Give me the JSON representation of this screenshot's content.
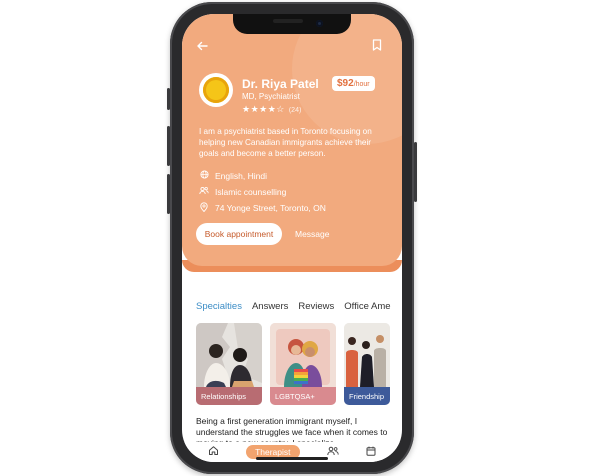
{
  "header": {
    "back_icon": "arrow-left-icon",
    "bookmark_icon": "bookmark-icon"
  },
  "therapist": {
    "name": "Dr. Riya Patel",
    "credentials": "MD, Psychiatrist",
    "stars": "★★★★☆",
    "rating": 4,
    "review_count": "(24)",
    "price": "$92",
    "price_unit": "/hour",
    "bio": "I am a psychiatrist based in Toronto focusing on helping new Canadian immigrants achieve their goals and become a better person.",
    "languages": "English, Hindi",
    "counselling": "Islamic counselling",
    "address": "74 Yonge Street, Toronto, ON"
  },
  "actions": {
    "book_label": "Book appointment",
    "message_label": "Message"
  },
  "tabs": [
    {
      "label": "Specialties",
      "active": true
    },
    {
      "label": "Answers",
      "active": false
    },
    {
      "label": "Reviews",
      "active": false
    },
    {
      "label": "Office Ame",
      "active": false
    }
  ],
  "specialties": [
    {
      "label": "Relationships",
      "color": "#b86c72"
    },
    {
      "label": "LGBTQSA+",
      "color": "#d98a8f"
    },
    {
      "label": "Friendship",
      "color": "#3d5a9a"
    }
  ],
  "about_text": "Being a first generation immigrant myself, I understand the struggles we face when it comes to moving to a new country. I specialize",
  "bottom_nav": {
    "home_icon": "home-icon",
    "active_label": "Therapist",
    "people_icon": "people-icon",
    "calendar_icon": "calendar-icon"
  },
  "colors": {
    "hero": "#f2aa7e",
    "accent": "#e2703e",
    "active_tab": "#3c8dc6"
  }
}
